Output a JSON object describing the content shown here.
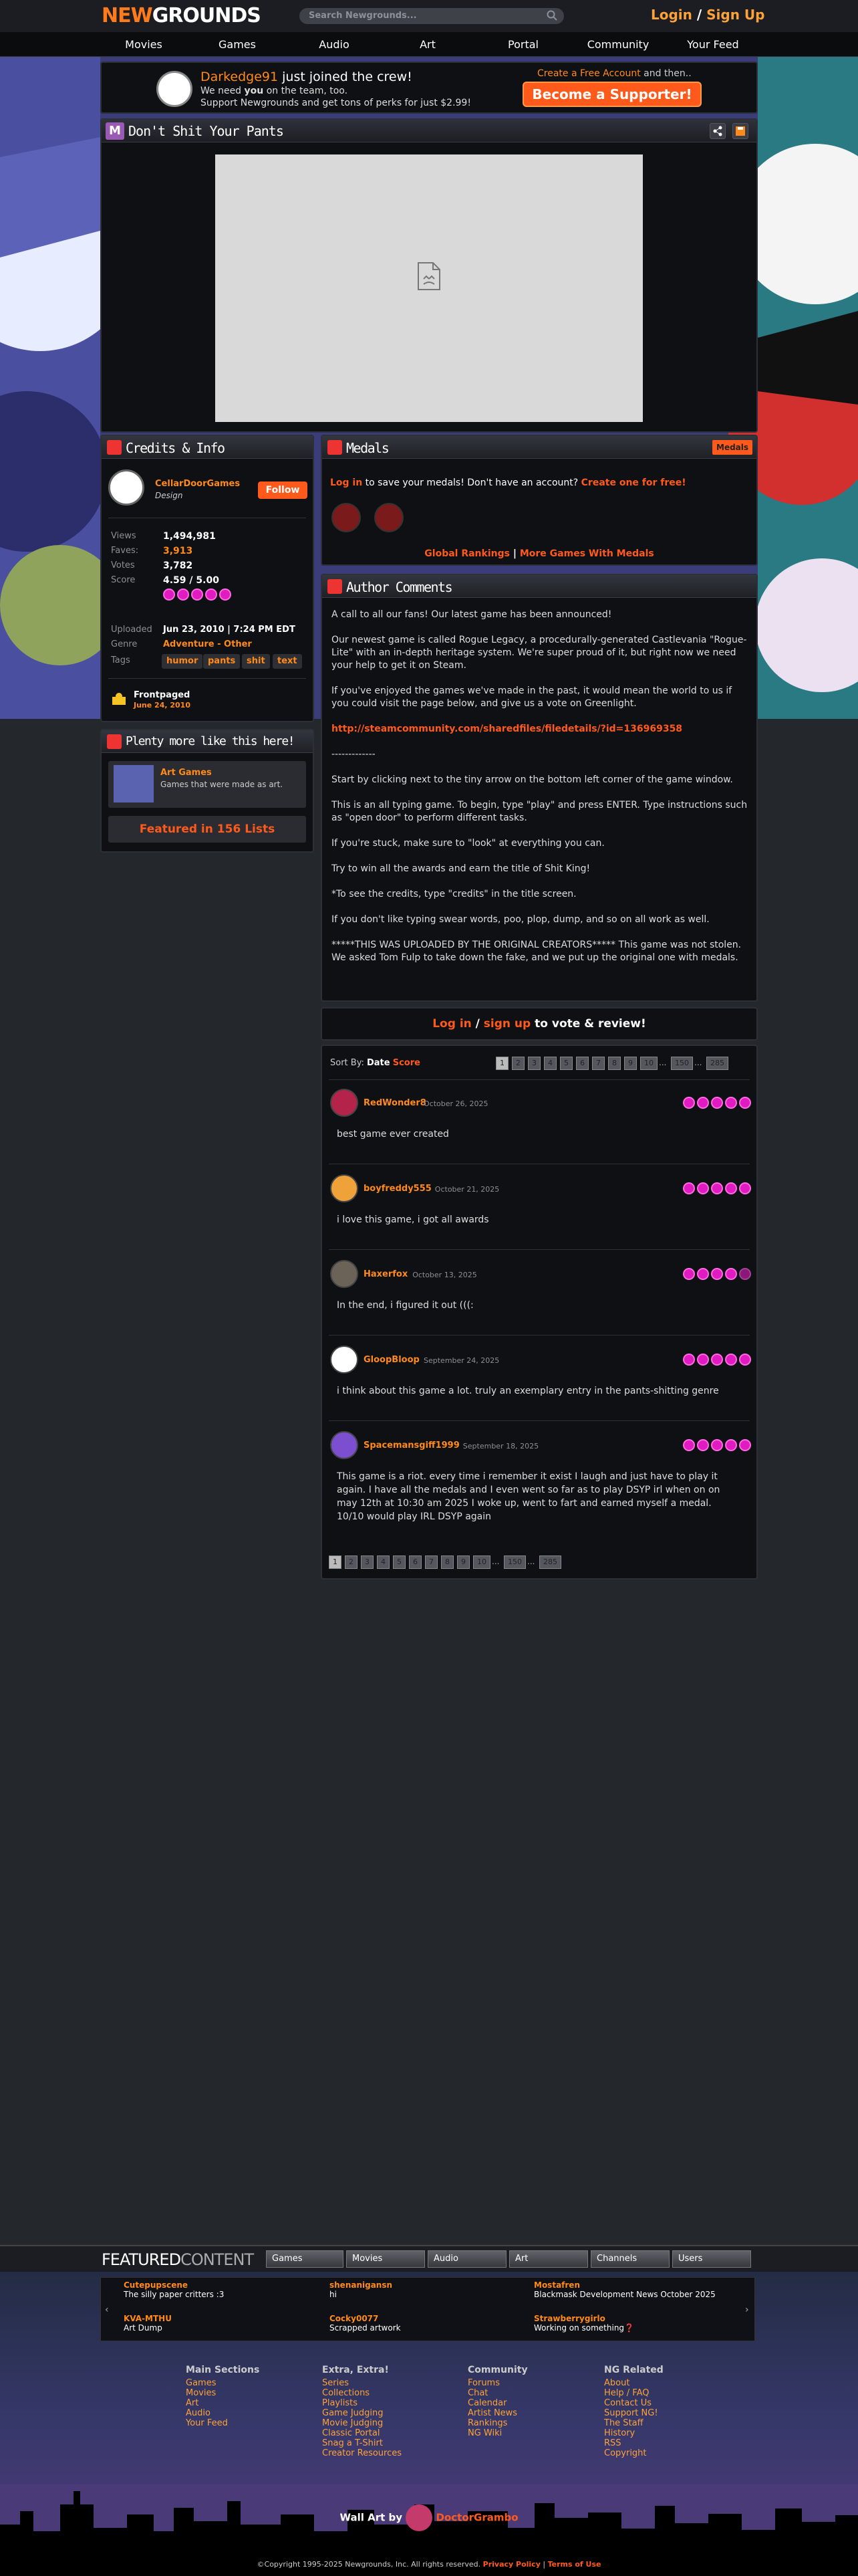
{
  "header": {
    "logo_prefix": "NEW",
    "logo_suffix": "GROUNDS",
    "search_placeholder": "Search Newgrounds...",
    "login": "Login",
    "sep": "/",
    "signup": "Sign Up"
  },
  "nav": [
    "Movies",
    "Games",
    "Audio",
    "Art",
    "Portal",
    "Community",
    "Your Feed"
  ],
  "supporter": {
    "user": "Darkedge91",
    "joined": " just joined the crew!",
    "line2a": "We need ",
    "line2b": "you",
    "line2c": " on the team, too.",
    "line3": "Support Newgrounds and get tons of perks for just $2.99!",
    "create": "Create a Free Account",
    "create_after": " and then..",
    "button": "Become a Supporter!"
  },
  "game": {
    "title": "Don't Shit Your Pants",
    "badge": "M"
  },
  "credits": {
    "title": "Credits & Info",
    "author": "CellarDoorGames",
    "role": "Design",
    "follow": "Follow",
    "views_l": "Views",
    "views": "1,494,981",
    "faves_l": "Faves:",
    "faves": "3,913",
    "votes_l": "Votes",
    "votes": "3,782",
    "score_l": "Score",
    "score": "4.59 / 5.00",
    "uploaded_l": "Uploaded",
    "uploaded": "Jun 23, 2010",
    "uploaded_time": "7:24 PM EDT",
    "genre_l": "Genre",
    "genre": "Adventure - Other",
    "tags_l": "Tags",
    "tags": [
      "humor",
      "pants",
      "shit",
      "text"
    ],
    "frontpaged": "Frontpaged",
    "frontpaged_date": "June 24, 2010"
  },
  "plenty": {
    "title": "Plenty more like this here!",
    "item_title": "Art Games",
    "item_desc": "Games that were made as art.",
    "featured": "Featured in 156 Lists"
  },
  "medals": {
    "title": "Medals",
    "badge": "Medals",
    "login": "Log in",
    "login_rest": " to save your medals! Don't have an account? ",
    "create": "Create one for free!",
    "global": "Global Rankings",
    "sep": "|",
    "more": "More Games With Medals"
  },
  "comments": {
    "title": "Author Comments",
    "paragraphs": [
      "A call to all our fans! Our latest game has been announced!",
      "Our newest game is called Rogue Legacy, a procedurally-generated Castlevania \"Rogue-Lite\" with an in-depth heritage system. We're super proud of it, but right now we need your help to get it on Steam.",
      "If you've enjoyed the games we've made in the past, it would mean the world to us if you could visit the page below, and give us a vote on Greenlight.",
      "http://steamcommunity.com/sharedfiles/filedetails/?id=136969358",
      "-------------",
      "Start by clicking next to the tiny arrow on the bottom left corner of the game window.",
      "This is an all typing game. To begin, type \"play\" and press ENTER. Type instructions such as \"open door\" to perform different tasks.",
      "If you're stuck, make sure to \"look\" at everything you can.",
      "Try to win all the awards and earn the title of Shit King!",
      "*To see the credits, type \"credits\" in the title screen.",
      "If you don't like typing swear words, poo, plop, dump, and so on all work as well.",
      "*****THIS WAS UPLOADED BY THE ORIGINAL CREATORS***** This game was not stolen. We asked Tom Fulp to take down the fake, and we put up the original one with medals."
    ]
  },
  "vote": {
    "login": "Log in",
    "sep": " / ",
    "signup": "sign up",
    "rest": " to vote & review!"
  },
  "reviews": {
    "sort_label": "Sort By:",
    "sort_date": "Date",
    "sort_score": "Score",
    "pages": [
      "1",
      "2",
      "3",
      "4",
      "5",
      "6",
      "7",
      "8",
      "9",
      "10",
      "...",
      "150",
      "...",
      "285"
    ],
    "items": [
      {
        "name": "RedWonder8",
        "date": "October 26, 2025",
        "body": "best game ever created",
        "stars": 5,
        "color": "#b4234a"
      },
      {
        "name": "boyfreddy555",
        "date": "October 21, 2025",
        "body": "i love this game, i got all awards",
        "stars": 5,
        "color": "#f0a23a"
      },
      {
        "name": "Haxerfox",
        "date": "October 13, 2025",
        "body": "In the end, i figured it out (((:",
        "stars": 4.5,
        "color": "#6b6358"
      },
      {
        "name": "GloopBloop",
        "date": "September 24, 2025",
        "body": "i think about this game a lot. truly an exemplary entry in the pants-shitting genre",
        "stars": 5,
        "color": "#ffffff"
      },
      {
        "name": "Spacemansgiff1999",
        "date": "September 18, 2025",
        "body": "This game is a riot. every time i remember it exist I laugh and just have to play it again. I have all the medals and I even went so far as to play DSYP irl when on on may 12th at 10:30 am 2025 I woke up, went to fart and earned myself a medal. 10/10 would play IRL DSYP again",
        "stars": 5,
        "color": "#7b4fd0"
      }
    ]
  },
  "featured": {
    "title_a": "FEATURED",
    "title_b": "CONTENT",
    "buttons": [
      "Games",
      "Movies",
      "Audio",
      "Art",
      "Channels",
      "Users"
    ],
    "items": [
      {
        "a": "Cutepupscene",
        "b": "The silly paper critters :3"
      },
      {
        "a": "shenanigansn",
        "b": "hi"
      },
      {
        "a": "Mostafren",
        "b": "Blackmask Development News October 2025"
      },
      {
        "a": "KVA-MTHU",
        "b": "Art Dump"
      },
      {
        "a": "Cocky0077",
        "b": "Scrapped artwork"
      },
      {
        "a": "Strawberrygirlo",
        "b": "Working on something❓"
      }
    ]
  },
  "footer": {
    "cols": [
      {
        "h": "Main Sections",
        "links": [
          "Games",
          "Movies",
          "Art",
          "Audio",
          "Your Feed"
        ]
      },
      {
        "h": "Extra, Extra!",
        "links": [
          "Series",
          "Collections",
          "Playlists",
          "Game Judging",
          "Movie Judging",
          "Classic Portal",
          "Snag a T-Shirt",
          "Creator Resources"
        ]
      },
      {
        "h": "Community",
        "links": [
          "Forums",
          "Chat",
          "Calendar",
          "Artist News",
          "Rankings",
          "NG Wiki"
        ]
      },
      {
        "h": "NG Related",
        "links": [
          "About",
          "Help / FAQ",
          "Contact Us",
          "Support NG!",
          "The Staff",
          "History",
          "RSS",
          "Copyright"
        ]
      }
    ],
    "wallart": "Wall Art by",
    "wallart_user": "DoctorGrambo",
    "copyright": "©Copyright 1995-2025 Newgrounds, Inc. All rights reserved.",
    "privacy": "Privacy Policy",
    "terms": "Terms of Use"
  },
  "colors": {
    "accent": "#ff8a1a",
    "support_btn": "#ff5a1c",
    "star": "#e01bbf"
  }
}
